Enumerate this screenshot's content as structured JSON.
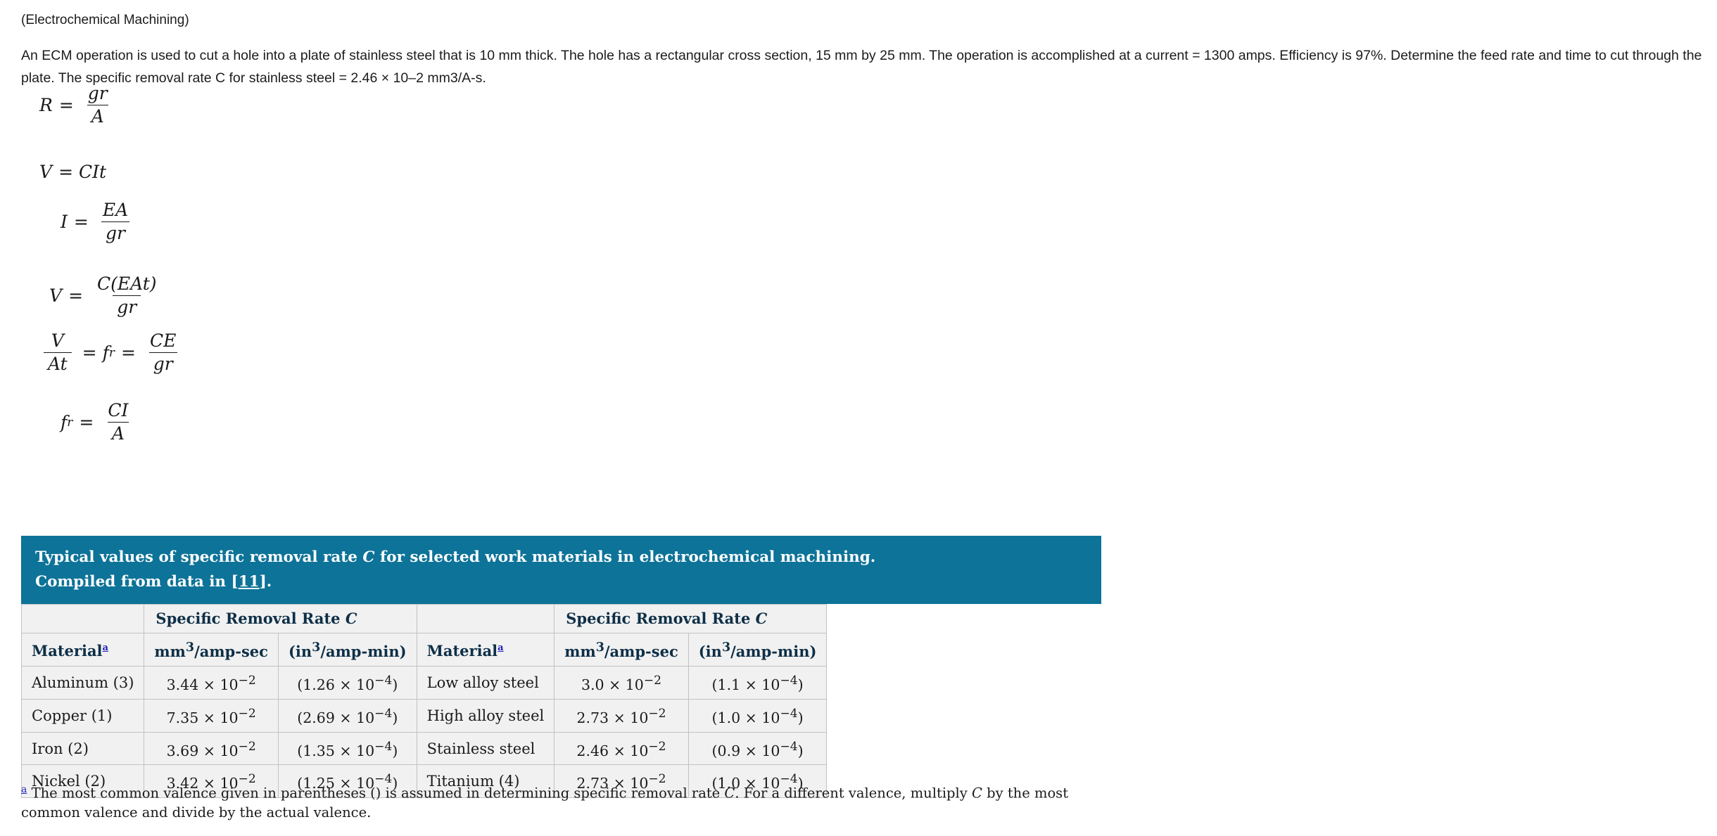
{
  "document": {
    "topic": "(Electrochemical Machining)",
    "problem": "An ECM operation is used to cut a hole into a plate of stainless steel that is 10 mm thick. The hole has a rectangular cross section, 15 mm by 25 mm. The operation is accomplished at a current = 1300 amps. Efficiency is 97%. Determine the feed rate and time to cut through the plate. The specific removal rate C for stainless steel = 2.46 × 10–2 mm3/A-s."
  },
  "equations": [
    {
      "id": "eq-R",
      "lhs": "R",
      "op": "=",
      "num": "gr",
      "den": "A"
    },
    {
      "id": "eq-V-CIt",
      "lhs": "V",
      "op": "=",
      "rhs": "CIt"
    },
    {
      "id": "eq-I",
      "lhs": "I",
      "op": "=",
      "num": "EA",
      "den": "gr"
    },
    {
      "id": "eq-V-frac",
      "lhs": "V",
      "op": "=",
      "num": "C(EAt)",
      "den": "gr"
    },
    {
      "id": "eq-fr-CE",
      "lnum": "V",
      "lden": "At",
      "op1": "=",
      "mid": "f",
      "midsub": "r",
      "op2": "=",
      "num": "CE",
      "den": "gr"
    },
    {
      "id": "eq-fr-CI",
      "lhs": "f",
      "lhssub": "r",
      "op": "=",
      "num": "CI",
      "den": "A"
    }
  ],
  "table": {
    "caption_line1_pre": "Typical values of specific removal rate ",
    "caption_line1_var": "C",
    "caption_line1_post": " for selected work materials in electrochemical machining.",
    "caption_line2_pre": "Compiled from data in [",
    "caption_line2_ref": "11",
    "caption_line2_post": "].",
    "caption_bg": "#0d7398",
    "group_header": "Specific Removal Rate C",
    "group_header_text": "Specific Removal Rate ",
    "group_header_var": "C",
    "headers": {
      "material": "Material",
      "footnote_mark": "a",
      "unit_mm": "mm3/amp-sec",
      "unit_mm_base": "mm",
      "unit_mm_exp": "3",
      "unit_mm_rest": "/amp-sec",
      "unit_in": "(in3/amp-min)",
      "unit_in_base": "(in",
      "unit_in_exp": "3",
      "unit_in_rest": "/amp-min)"
    },
    "rows": [
      {
        "left_material": "Aluminum (3)",
        "left_mm": "3.44 × 10−2",
        "left_mm_mant": "3.44 × 10",
        "left_mm_exp": "−2",
        "left_in": "(1.26 × 10−4)",
        "left_in_pre": "(1.26 × 10",
        "left_in_exp": "−4",
        "left_in_post": ")",
        "right_material": "Low alloy steel",
        "right_mm_mant": "3.0 × 10",
        "right_mm_exp": "−2",
        "right_in_pre": "(1.1 × 10",
        "right_in_exp": "−4",
        "right_in_post": ")"
      },
      {
        "left_material": "Copper (1)",
        "left_mm_mant": "7.35 × 10",
        "left_mm_exp": "−2",
        "left_in_pre": "(2.69 × 10",
        "left_in_exp": "−4",
        "left_in_post": ")",
        "right_material": "High alloy steel",
        "right_mm_mant": "2.73 × 10",
        "right_mm_exp": "−2",
        "right_in_pre": "(1.0 × 10",
        "right_in_exp": "−4",
        "right_in_post": ")"
      },
      {
        "left_material": "Iron (2)",
        "left_mm_mant": "3.69 × 10",
        "left_mm_exp": "−2",
        "left_in_pre": "(1.35 × 10",
        "left_in_exp": "−4",
        "left_in_post": ")",
        "right_material": "Stainless steel",
        "right_mm_mant": "2.46 × 10",
        "right_mm_exp": "−2",
        "right_in_pre": "(0.9 × 10",
        "right_in_exp": "−4",
        "right_in_post": ")"
      },
      {
        "left_material": "Nickel (2)",
        "left_mm_mant": "3.42 × 10",
        "left_mm_exp": "−2",
        "left_in_pre": "(1.25 × 10",
        "left_in_exp": "−4",
        "left_in_post": ")",
        "right_material": "Titanium (4)",
        "right_mm_mant": "2.73 × 10",
        "right_mm_exp": "−2",
        "right_in_pre": "(1.0 × 10",
        "right_in_exp": "−4",
        "right_in_post": ")"
      }
    ],
    "footnote": {
      "mark": "a",
      "part1": " The most common valence given in parentheses () is assumed in determining specific removal rate ",
      "var1": "C",
      "part2": ". For a different valence, multiply ",
      "var2": "C",
      "part3": " by the most common valence and divide by the actual valence."
    }
  }
}
